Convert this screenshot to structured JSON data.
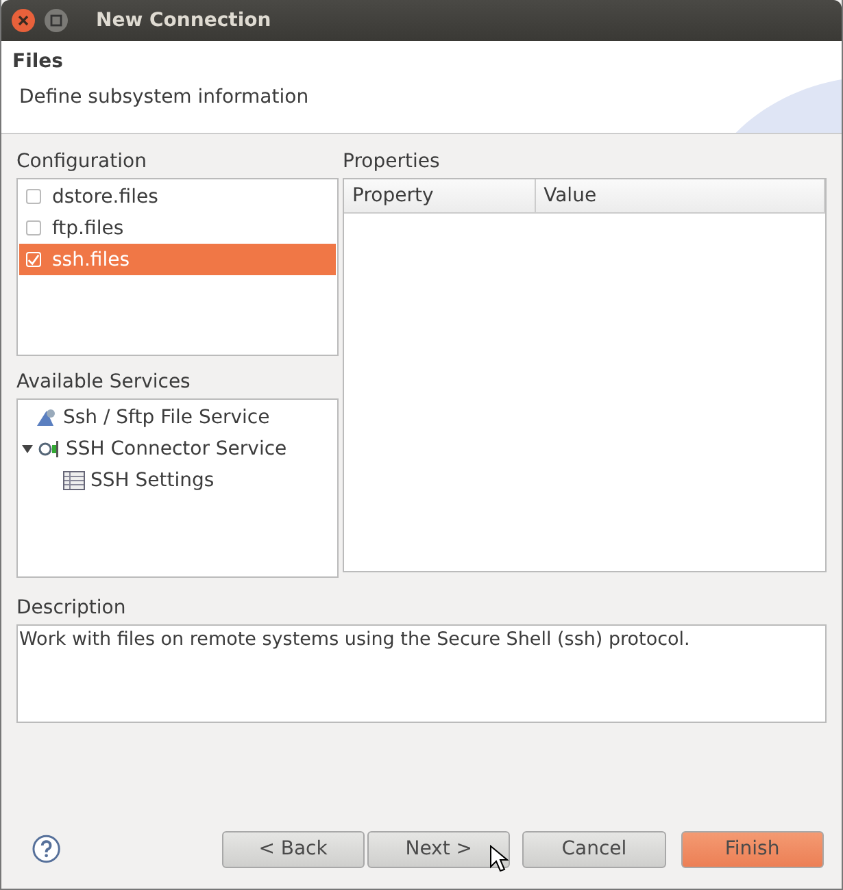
{
  "window": {
    "title": "New Connection"
  },
  "header": {
    "title": "Files",
    "description": "Define subsystem information"
  },
  "configuration": {
    "label": "Configuration",
    "items": [
      {
        "label": "dstore.files",
        "checked": false,
        "selected": false
      },
      {
        "label": "ftp.files",
        "checked": false,
        "selected": false
      },
      {
        "label": "ssh.files",
        "checked": true,
        "selected": true
      }
    ]
  },
  "available_services": {
    "label": "Available Services",
    "items": [
      {
        "label": "Ssh / Sftp File Service",
        "kind": "service"
      },
      {
        "label": "SSH Connector Service",
        "kind": "connector",
        "expanded": true,
        "children": [
          {
            "label": "SSH Settings",
            "kind": "settings"
          }
        ]
      }
    ]
  },
  "properties": {
    "label": "Properties",
    "columns": [
      "Property",
      "Value"
    ]
  },
  "description": {
    "label": "Description",
    "text": "Work with files on remote systems using the Secure Shell (ssh) protocol."
  },
  "buttons": [
    {
      "label": "< Back",
      "kind": "normal"
    },
    {
      "label": "Next >",
      "kind": "normal"
    },
    {
      "label": "Cancel",
      "kind": "normal"
    },
    {
      "label": "Finish",
      "kind": "default"
    }
  ]
}
